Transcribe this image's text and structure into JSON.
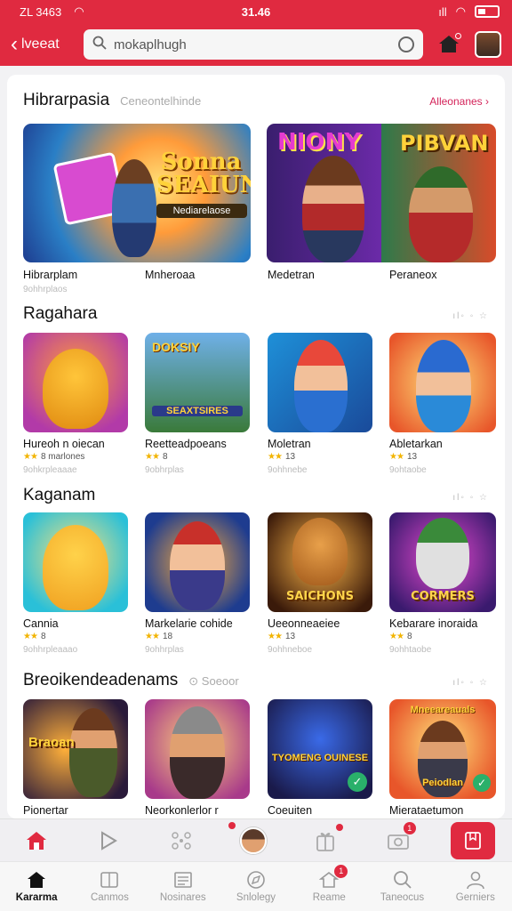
{
  "status": {
    "carrier": "ZL 3463",
    "time": "31.46"
  },
  "header": {
    "back_label": "lveeat",
    "search_placeholder": "mokaplhugh"
  },
  "sections": [
    {
      "title": "Hibrarpasia",
      "subtitle": "Ceneontelhinde",
      "link": "Alleonanes ›"
    },
    {
      "title": "Ragahara",
      "more": "ıl◦ ◦ ☆"
    },
    {
      "title": "Kaganam",
      "more": "ıl◦ ◦ ☆"
    },
    {
      "title": "Breoikendeadenams",
      "subtitle": "⊙ Soeoor",
      "more": "ıl◦ ◦ ☆"
    }
  ],
  "featured": [
    {
      "art_text": "Sonna SEAIUN",
      "sub_art": "Nediarelaose",
      "name": "Hibrarplam",
      "meta": "9ohhrplaos"
    },
    {
      "art_text": "NIONY",
      "name": "Mnheroaa",
      "meta": ""
    },
    {
      "name": "Medetran",
      "meta": ""
    },
    {
      "art_text": "PIBVAN",
      "name": "Peraneox",
      "meta": ""
    }
  ],
  "row1": [
    {
      "name": "Hureoh n oiecan",
      "stars": "★★",
      "rating": "8 marlones",
      "meta": "9ohkrpleaaae"
    },
    {
      "art_text": "DOKSIY",
      "sub_art": "SEAXTSIRES",
      "name": "Reetteadpoeans",
      "stars": "★★",
      "rating": "8",
      "meta": "9obhrplas"
    },
    {
      "name": "Moletran",
      "stars": "★★",
      "rating": "13",
      "meta": "9ohhnebe"
    },
    {
      "name": "Abletarkan",
      "stars": "★★",
      "rating": "13",
      "meta": "9ohtaobe"
    }
  ],
  "row2": [
    {
      "name": "Cannia",
      "stars": "★★",
      "rating": "8",
      "meta": "9ohhrpleaaao"
    },
    {
      "name": "Markelarie cohide",
      "stars": "★★",
      "rating": "18",
      "meta": "9ohhrplas"
    },
    {
      "art_text": "SAICHONS",
      "name": "Ueeonneaeiee",
      "stars": "★★",
      "rating": "13",
      "meta": "9ohhneboe"
    },
    {
      "art_text": "CORMERS",
      "name": "Kebarare inoraida",
      "stars": "★★",
      "rating": "8",
      "meta": "9ohhtaobe"
    }
  ],
  "row3": [
    {
      "art_text": "Braoan",
      "name": "Pionertar"
    },
    {
      "name": "Neorkonlerlor r"
    },
    {
      "art_text": "TYOMENG OUINESE",
      "name": "Coeuiten"
    },
    {
      "art_text": "Mneeareauals",
      "sub_art": "Peiodlan",
      "name": "Mierataetumon"
    }
  ],
  "actionbar": {
    "badge_a": "",
    "badge_b": "1"
  },
  "nav": [
    {
      "label": "Kararma"
    },
    {
      "label": "Canmos"
    },
    {
      "label": "Nosinares"
    },
    {
      "label": "Snlolegy"
    },
    {
      "label": "Reame",
      "badge": "1"
    },
    {
      "label": "Taneocus"
    },
    {
      "label": "Gerniers"
    }
  ],
  "colors": {
    "brand": "#e02a40",
    "accent_link": "#d4245a",
    "star": "#f2b400"
  }
}
